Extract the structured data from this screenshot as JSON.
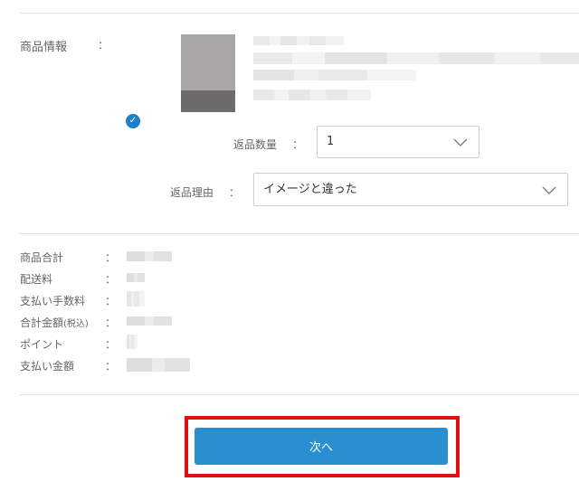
{
  "product": {
    "label": "商品情報",
    "colon": "："
  },
  "return_quantity": {
    "label": "返品数量",
    "colon": "：",
    "selected": "1"
  },
  "return_reason": {
    "label": "返品理由",
    "colon": "：",
    "selected": "イメージと違った"
  },
  "summary": {
    "colon": "：",
    "rows": [
      {
        "label": "商品合計"
      },
      {
        "label": "配送料"
      },
      {
        "label": "支払い手数料"
      },
      {
        "label": "合計金額",
        "sub": "(税込)"
      },
      {
        "label": "ポイント"
      },
      {
        "label": "支払い金額"
      }
    ]
  },
  "next_button": {
    "label": "次へ"
  },
  "colors": {
    "accent": "#2a8fd0",
    "highlight": "#e21010",
    "check": "#1e7fc7"
  },
  "icons": [
    "check-icon",
    "chevron-down-icon"
  ]
}
